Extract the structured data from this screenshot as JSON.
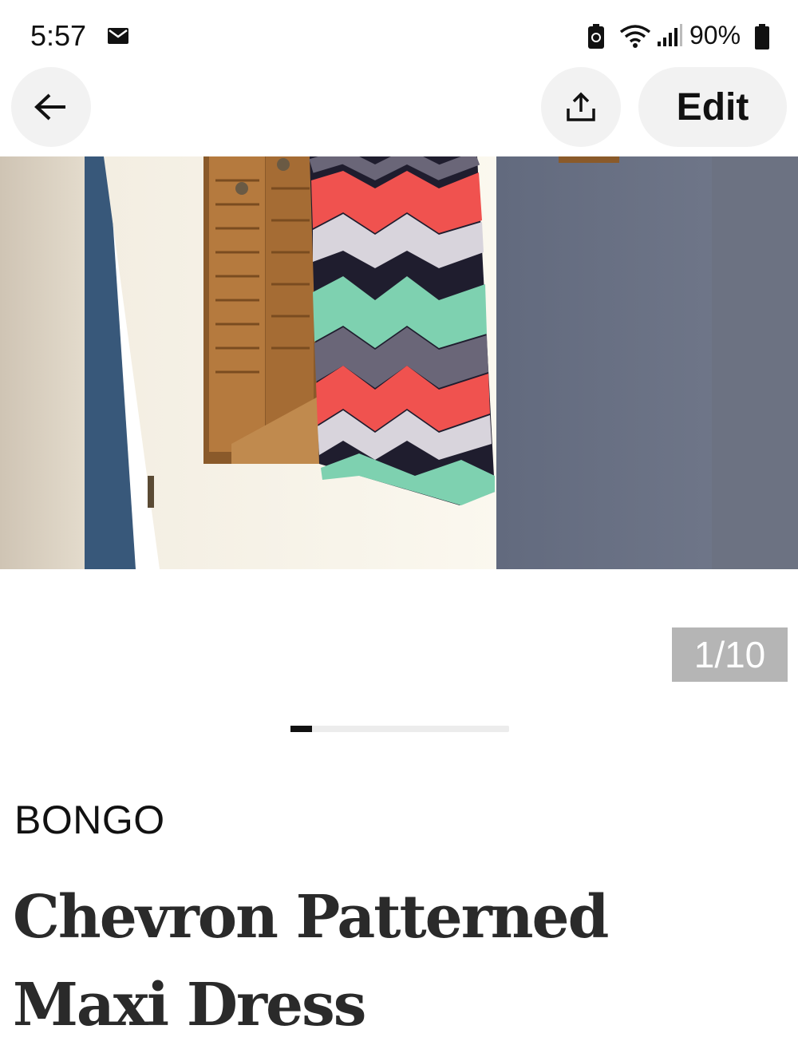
{
  "status_bar": {
    "time": "5:57",
    "battery_percent": "90%",
    "icons": [
      "mail-icon",
      "battery-saver-icon",
      "wifi-icon",
      "signal-icon",
      "battery-icon"
    ]
  },
  "toolbar": {
    "back_icon": "arrow-left-icon",
    "share_icon": "share-upload-icon",
    "edit_label": "Edit"
  },
  "gallery": {
    "counter": "1/10",
    "current_index": 1,
    "total": 10,
    "scroll_progress": 0.1
  },
  "listing": {
    "brand": "BONGO",
    "title": "Chevron Patterned Maxi Dress"
  },
  "colors": {
    "button_bg": "#f2f2f2",
    "counter_bg": "#b5b5b5",
    "chevron_coral": "#f0524f",
    "chevron_mint": "#7ed1b0",
    "chevron_navy": "#1f1d2e",
    "chevron_gray": "#6a6678"
  }
}
